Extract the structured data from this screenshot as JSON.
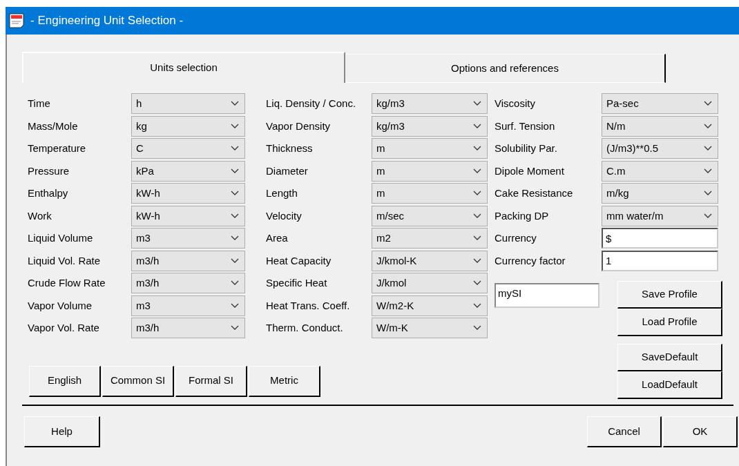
{
  "window": {
    "title": "- Engineering Unit Selection -"
  },
  "tabs": [
    {
      "label": "Units selection",
      "selected": true
    },
    {
      "label": "Options and references",
      "selected": false
    }
  ],
  "columns": [
    {
      "rows": [
        {
          "kind": "combo",
          "label": "Time",
          "value": "h"
        },
        {
          "kind": "combo",
          "label": "Mass/Mole",
          "value": "kg"
        },
        {
          "kind": "combo",
          "label": "Temperature",
          "value": "C"
        },
        {
          "kind": "combo",
          "label": "Pressure",
          "value": "kPa"
        },
        {
          "kind": "combo",
          "label": "Enthalpy",
          "value": "kW-h"
        },
        {
          "kind": "combo",
          "label": "Work",
          "value": "kW-h"
        },
        {
          "kind": "combo",
          "label": "Liquid Volume",
          "value": "m3"
        },
        {
          "kind": "combo",
          "label": "Liquid Vol. Rate",
          "value": "m3/h"
        },
        {
          "kind": "combo",
          "label": "Crude Flow Rate",
          "value": "m3/h"
        },
        {
          "kind": "combo",
          "label": "Vapor Volume",
          "value": "m3"
        },
        {
          "kind": "combo",
          "label": "Vapor Vol. Rate",
          "value": "m3/h"
        }
      ]
    },
    {
      "rows": [
        {
          "kind": "combo",
          "label": "Liq. Density / Conc.",
          "value": "kg/m3"
        },
        {
          "kind": "combo",
          "label": "Vapor Density",
          "value": "kg/m3"
        },
        {
          "kind": "combo",
          "label": "Thickness",
          "value": "m"
        },
        {
          "kind": "combo",
          "label": "Diameter",
          "value": "m"
        },
        {
          "kind": "combo",
          "label": "Length",
          "value": "m"
        },
        {
          "kind": "combo",
          "label": "Velocity",
          "value": "m/sec"
        },
        {
          "kind": "combo",
          "label": "Area",
          "value": "m2"
        },
        {
          "kind": "combo",
          "label": "Heat Capacity",
          "value": "J/kmol-K"
        },
        {
          "kind": "combo",
          "label": "Specific Heat",
          "value": "J/kmol"
        },
        {
          "kind": "combo",
          "label": "Heat Trans. Coeff.",
          "value": "W/m2-K"
        },
        {
          "kind": "combo",
          "label": "Therm. Conduct.",
          "value": "W/m-K"
        }
      ]
    },
    {
      "rows": [
        {
          "kind": "combo",
          "label": "Viscosity",
          "value": "Pa-sec"
        },
        {
          "kind": "combo",
          "label": "Surf. Tension",
          "value": "N/m"
        },
        {
          "kind": "combo",
          "label": "Solubility Par.",
          "value": "(J/m3)**0.5"
        },
        {
          "kind": "combo",
          "label": "Dipole Moment",
          "value": "C.m"
        },
        {
          "kind": "combo",
          "label": "Cake Resistance",
          "value": "m/kg"
        },
        {
          "kind": "combo",
          "label": "Packing DP",
          "value": "mm water/m"
        },
        {
          "kind": "text",
          "label": "Currency",
          "value": "$"
        },
        {
          "kind": "text",
          "label": "Currency factor",
          "value": "1"
        }
      ]
    }
  ],
  "profile_name": {
    "value": "mySI"
  },
  "profile_buttons": [
    "Save Profile",
    "Load Profile",
    "SaveDefault",
    "LoadDefault"
  ],
  "presets": [
    "English",
    "Common SI",
    "Formal SI",
    "Metric"
  ],
  "buttons": [
    "Help",
    "Cancel",
    "OK"
  ]
}
